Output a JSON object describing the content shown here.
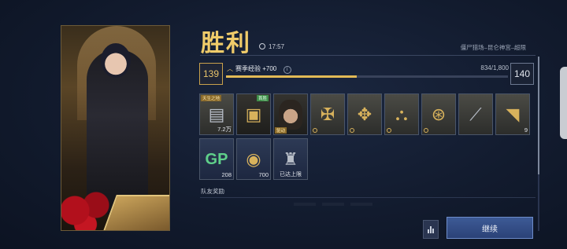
{
  "result": {
    "title": "胜利",
    "time": "17:57",
    "mode": "僵尸猎场–昆仑神宫–超限"
  },
  "progress": {
    "current_level": "139",
    "next_level": "140",
    "exp_label": "赛季经验",
    "exp_gain": "+700",
    "exp_value": "834/1,800",
    "exp_fraction": 0.463
  },
  "rewards_row1": [
    {
      "icon": "cash-stack-icon",
      "tag": "天生之地",
      "qty": "7.2万"
    },
    {
      "icon": "crate-icon",
      "tag": "首胜",
      "qty": ""
    },
    {
      "icon": "operator-portrait-icon",
      "tag": "驱动",
      "qty": ""
    },
    {
      "icon": "emblem-icon-1",
      "qty": ""
    },
    {
      "icon": "emblem-icon-2",
      "qty": ""
    },
    {
      "icon": "emblem-icon-3",
      "qty": ""
    },
    {
      "icon": "emblem-icon-4",
      "qty": ""
    },
    {
      "icon": "rifle-icon",
      "qty": ""
    },
    {
      "icon": "gold-shard-icon",
      "qty": "9"
    }
  ],
  "rewards_row2": [
    {
      "icon": "gp-icon",
      "glyph": "GP",
      "qty": "208"
    },
    {
      "icon": "battle-pass-coin-icon",
      "qty": "700"
    },
    {
      "icon": "rank-badge-icon",
      "caption": "已达上限"
    }
  ],
  "team_rewards_label": "队友奖励",
  "buttons": {
    "continue": "继续"
  },
  "colors": {
    "accent_gold": "#e9c46a",
    "button_blue": "#2b4277"
  }
}
